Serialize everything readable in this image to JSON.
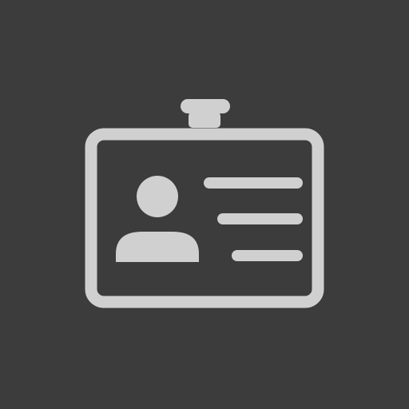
{
  "icon": {
    "name": "id-badge-icon",
    "background_color": "#3c3c3c",
    "glyph_color": "#d0d0d0"
  }
}
